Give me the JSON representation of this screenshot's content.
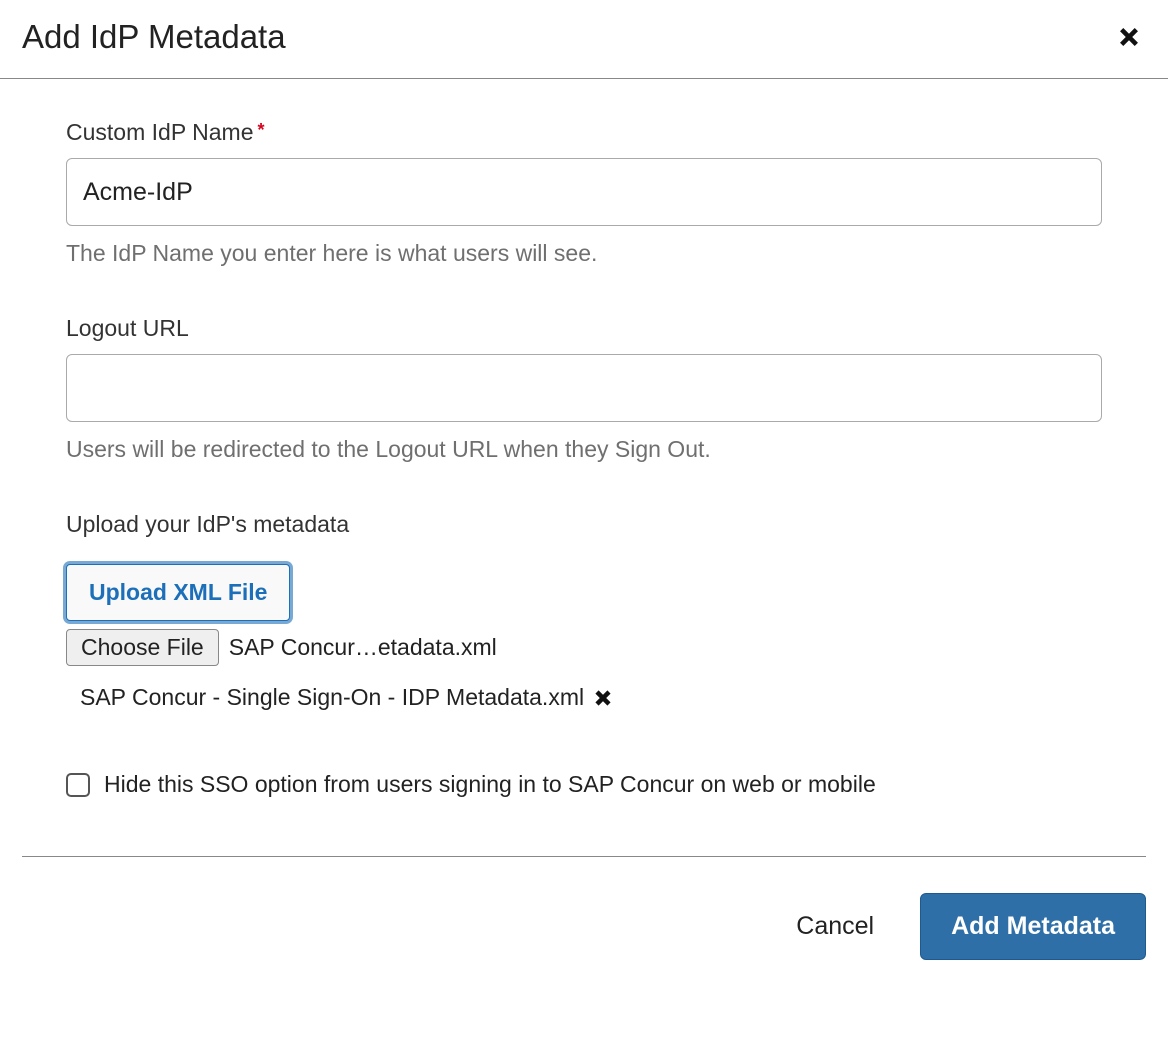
{
  "header": {
    "title": "Add IdP Metadata"
  },
  "form": {
    "idp_name": {
      "label": "Custom IdP Name",
      "value": "Acme-IdP",
      "help": "The IdP Name you enter here is what users will see."
    },
    "logout_url": {
      "label": "Logout URL",
      "value": "",
      "help": "Users will be redirected to the Logout URL when they Sign Out."
    },
    "upload": {
      "section_label": "Upload your IdP's metadata",
      "button_label": "Upload XML File",
      "choose_file_label": "Choose File",
      "chosen_file_short": "SAP Concur…etadata.xml",
      "uploaded_file_name": "SAP Concur - Single Sign-On - IDP Metadata.xml"
    },
    "hide_option": {
      "label": "Hide this SSO option from users signing in to SAP Concur on web or mobile",
      "checked": false
    }
  },
  "footer": {
    "cancel_label": "Cancel",
    "submit_label": "Add Metadata"
  }
}
